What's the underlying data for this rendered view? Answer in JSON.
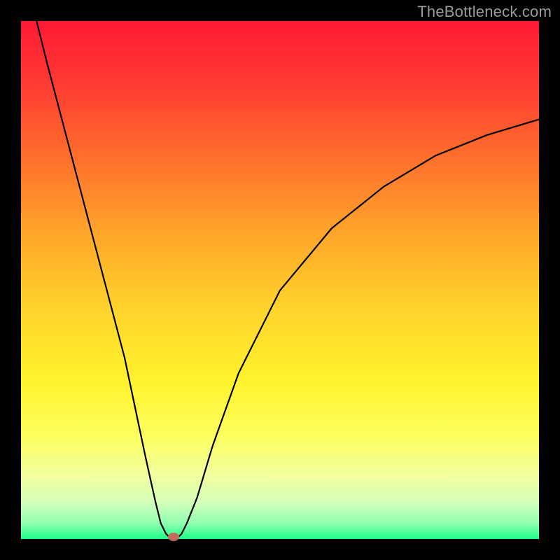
{
  "watermark": "TheBottleneck.com",
  "chart_data": {
    "type": "line",
    "title": "",
    "xlabel": "",
    "ylabel": "",
    "xlim": [
      0,
      100
    ],
    "ylim": [
      0,
      100
    ],
    "grid": false,
    "legend": false,
    "series": [
      {
        "name": "bottleneck-curve",
        "x": [
          3,
          5,
          10,
          15,
          20,
          24,
          26,
          27,
          28,
          29,
          30,
          31,
          32,
          34,
          37,
          42,
          50,
          60,
          70,
          80,
          90,
          100
        ],
        "values": [
          100,
          92,
          73,
          54,
          35,
          16,
          7,
          3,
          1,
          0,
          0,
          1,
          3,
          8,
          18,
          32,
          48,
          60,
          68,
          74,
          78,
          81
        ]
      }
    ],
    "marker": {
      "x": 29.5,
      "y": 0.4,
      "color": "#c56a5a"
    },
    "background_gradient": [
      "#ff1935",
      "#ffd22b",
      "#1fff86"
    ]
  }
}
